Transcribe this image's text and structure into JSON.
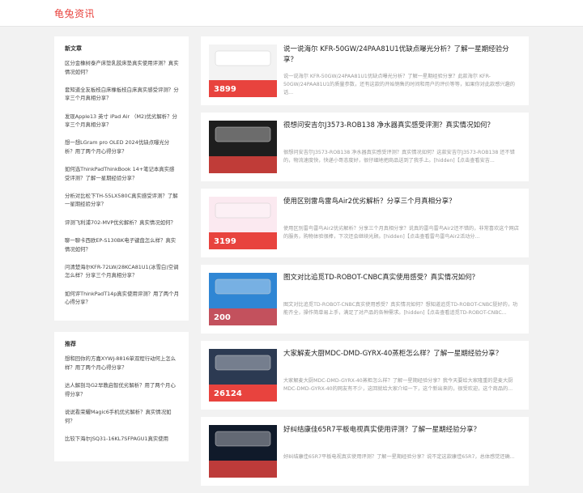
{
  "site": {
    "logo": "龟兔资讯"
  },
  "sidebar": {
    "new_title": "新文章",
    "new_items": [
      "区分金橡树泰产床垫乳胶床垫真实使用评测？真实情况如何？",
      "套知道全友板枝白床橡板枝白床真实感受评测？分享三个月真相分享？",
      "发现Apple13 英寸 iPad Air （M2)优劣解析？分享三个月真相分享？",
      "想一想LGram pro OLED 2024优缺点曝光分析？用了两个月心得分享？",
      "如何选ThinkPadThinkBook 14+笔记本真实感受评测？了解一星期经验分享？",
      "分析对比松下TH-55LX580C真实感受评测？了解一星期经验分享？",
      "评测飞利浦702-MVP优劣解析？真实情况如何？",
      "聊一聊卡西欧EP-S130BK电子键盘怎么样？真实情况如何？",
      "问清楚海尔KFR-72LW/28KCA81U1(冰雪白)空调怎么样？分享三个月真相分享？",
      "如何评ThinkPadT14p真实使用评测？用了两个月心得分享？"
    ],
    "rec_title": "推荐",
    "rec_items": [
      "想和回你的方嘉XYWJ-8816单双程行动何上怎么样？用了两个月心得分享？",
      "达人解剖马G2早教启智优劣解析？用了两个月心得分享？",
      "说说看荣耀Magic6手机优劣解析？真实情况如何？",
      "比较下海尔JSQ31-16KL7SFPAGU1真实使用"
    ]
  },
  "articles": [
    {
      "title": "说一说海尔 KFR-50GW/24PAA81U1优缺点曝光分析？了解一星期经验分享？",
      "desc": "说一说海尔 KFR-50GW/24PAA81U1优缺点曝光分析？了解一星期经验分享？此款海尔 KFR-50GW/24PAA81U1的质量参数，还有这款的开始销售的时间和用户的评价等等，如果你对此款感兴趣的话...",
      "thumb_price": "3899",
      "thumb_color": "#f3f3f3"
    },
    {
      "title": "很想问安吉尔J3573-ROB138 净水器真实感受评测？真实情况如何？",
      "desc": "很想问安吉尔J3573-ROB138 净水器真实感受评测？真实情况如何？这款安吉尔J3573-ROB138 还不错的，物流速度快，快递小哥态度好，很仔细地把商品送到了我手上。[hidden]【点击查看安吉...",
      "thumb_price": "",
      "thumb_color": "#1e1e1e"
    },
    {
      "title": "使用区别雷鸟雷鸟Air2优劣解析？分享三个月真相分享？",
      "desc": "使用区别雷鸟雷鸟Air2优劣解析？分享三个月真相分享？说真的雷鸟雷鸟Air2还不错的，非常喜欢这个网店的服务，购物体验很棒，下次还会继续光顾。[hidden]【点击查看雷鸟雷鸟Air2活动分...",
      "thumb_price": "3199",
      "thumb_color": "#fbe9f0"
    },
    {
      "title": "图文对比追觅TD-ROBOT-CNBC真实使用感受？真实情况如何？",
      "desc": "图文对比追觅TD-ROBOT-CNBC真实使用感受？真实情况如何？想知道追觅TD-ROBOT-CNBC挺好的，功能齐全，操作简单易上手，满足了对产品的各种需求。[hidden]【点击查看追觅TD-ROBOT-CNBC...",
      "thumb_price": "200",
      "thumb_color": "#2f86d4"
    },
    {
      "title": "大家解麦大厨MDC-DMD-GYRX-40蒸柜怎么样？了解一星期经验分享？",
      "desc": "大家解麦大厨MDC-DMD-GYRX-40蒸柜怎么样？了解一星期经验分享？我今天要给大家隆重的是麦大厨MDC-DMD-GYRX-40的网友有不少，这回就给大家介绍一下，这个新出来的，很受欢迎，这个商品的...",
      "thumb_price": "26124",
      "thumb_color": "#2c3a52"
    },
    {
      "title": "好纠结康佳65R7平板电视真实使用评测？了解一星期经验分享？",
      "desc": "好纠结康佳65R7平板电视真实使用评测？了解一星期经验分享？说不定这款康佳65R7，总体感觉还确...",
      "thumb_price": "",
      "thumb_color": "#101a2a"
    }
  ]
}
